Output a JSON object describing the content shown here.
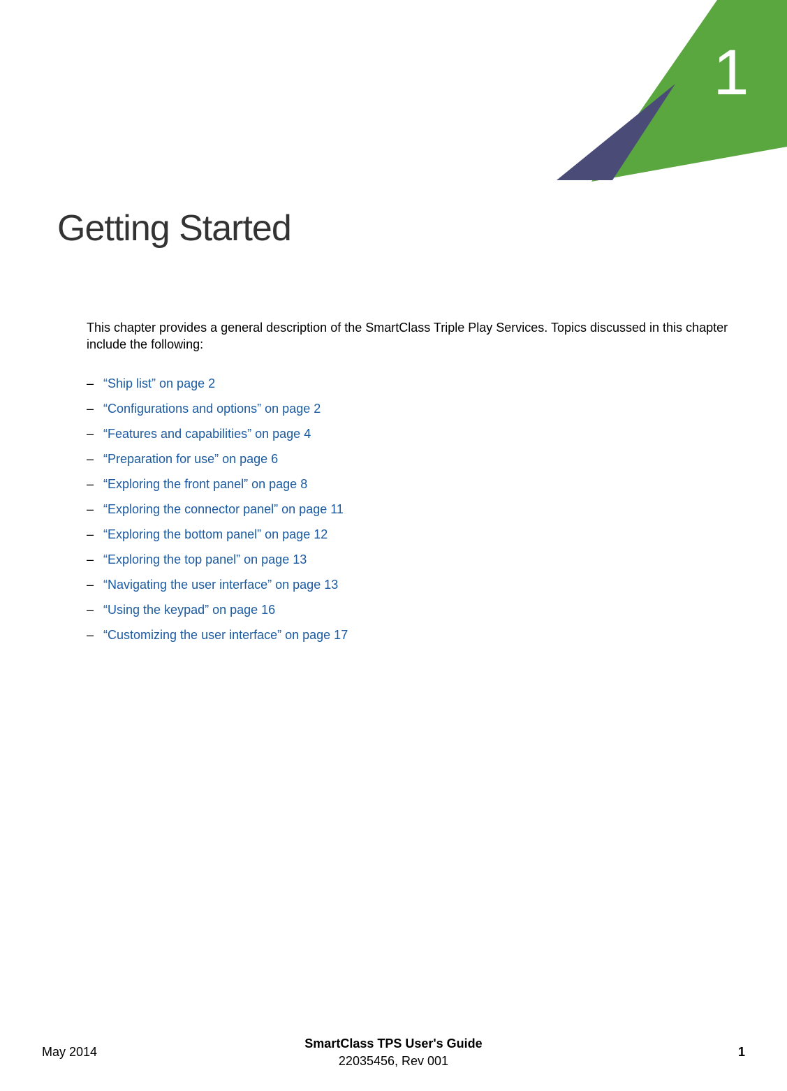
{
  "chapter": {
    "number": "1",
    "title": "Getting Started"
  },
  "intro": "This chapter provides a general description of the SmartClass Triple Play Services. Topics discussed in this chapter include the following:",
  "toc": [
    "“Ship list” on page 2",
    "“Configurations and options” on page 2",
    "“Features and capabilities” on page 4",
    "“Preparation for use” on page 6",
    "“Exploring the front panel” on page 8",
    "“Exploring the connector panel” on page 11",
    "“Exploring the bottom panel” on page 12",
    "“Exploring the top panel” on page 13",
    "“Navigating the user interface” on page 13",
    "“Using the keypad” on page 16",
    "“Customizing the user interface” on page 17"
  ],
  "footer": {
    "date": "May 2014",
    "guide_title": "SmartClass TPS User's Guide",
    "doc_rev": "22035456, Rev 001",
    "page_number": "1"
  }
}
